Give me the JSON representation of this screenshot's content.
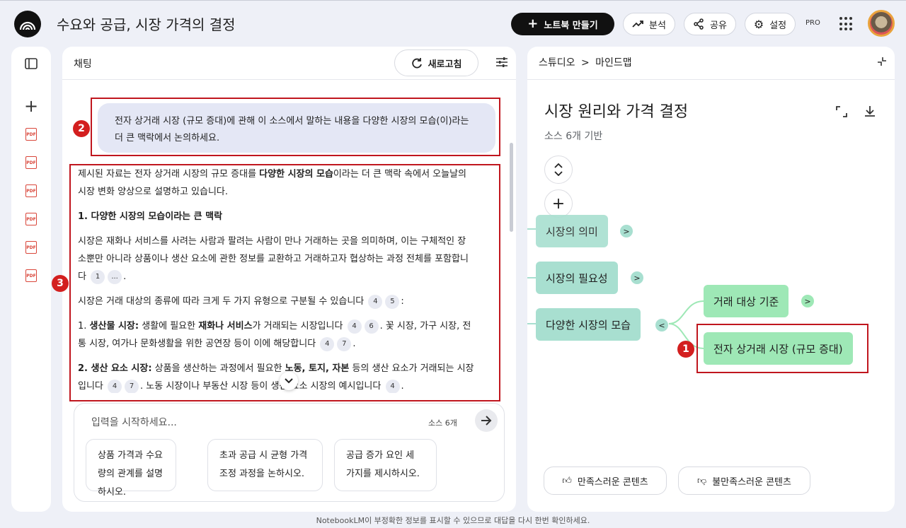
{
  "header": {
    "title": "수요와 공급, 시장 가격의 결정",
    "new_notebook": "노트북 만들기",
    "analytics": "분석",
    "share": "공유",
    "settings": "설정",
    "pro": "PRO"
  },
  "chat": {
    "title": "채팅",
    "refresh": "새로고침",
    "user_message": "전자 상거래 시장 (규모 증대)에 관해 이 소스에서 말하는 내용을 다양한 시장의 모습(이)라는 더 큰 맥락에서 논의하세요.",
    "answer": {
      "intro_1": "제시된 자료는 전자 상거래 시장의 규모 증대를 ",
      "intro_bold": "다양한 시장의 모습",
      "intro_2": "이라는 더 큰 맥락 속에서 오늘날의 시장 변화 양상으로 설명하고 있습니다.",
      "heading_1": "1. 다양한 시장의 모습이라는 큰 맥락",
      "para_1": "시장은 재화나 서비스를 사려는 사람과 팔려는 사람이 만나 거래하는 곳을 의미하며, 이는 구체적인 장소뿐만 아니라 상품이나 생산 요소에 관한 정보를 교환하고 거래하고자 협상하는 과정 전체를 포함합니다",
      "para_1_cites": [
        "1",
        "..."
      ],
      "para_2": "시장은 거래 대상의 종류에 따라 크게 두 가지 유형으로 구분될 수 있습니다",
      "para_2_cites": [
        "4",
        "5"
      ],
      "item_1_num": "1. ",
      "item_1_label": "생산물 시장:",
      "item_1_a": " 생활에 필요한 ",
      "item_1_bold": "재화나 서비스",
      "item_1_b": "가 거래되는 시장입니다",
      "item_1_cites": [
        "4",
        "6"
      ],
      "item_1_c": ". 꽃 시장, 가구 시장, 전통 시장, 여가나 문화생활을 위한 공연장 등이 이에 해당합니다",
      "item_1_cites_2": [
        "4",
        "7"
      ],
      "item_2_num": "2. ",
      "item_2_label": "생산 요소 시장:",
      "item_2_a": " 상품을 생산하는 과정에서 필요한 ",
      "item_2_bold": "노동, 토지, 자본",
      "item_2_b": " 등의 생산 요소가 거래되는 시장입니다",
      "item_2_cites": [
        "4",
        "7"
      ],
      "item_2_c": ". 노동 시장이나 부동산 시장 등이 생산 요소 시장의 예시입니다",
      "item_2_cites_2": [
        "4"
      ]
    },
    "input_placeholder": "입력을 시작하세요...",
    "source_count": "소스 6개",
    "suggestions": [
      "상품 가격과 수요량의 관계를 설명하시오.",
      "초과 공급 시 균형 가격 조정 과정을 논하시오.",
      "공급 증가 요인 세 가지를 제시하시오."
    ]
  },
  "studio": {
    "breadcrumb_1": "스튜디오",
    "breadcrumb_2": "마인드맵",
    "map_title": "시장 원리와 가격 결정",
    "map_subtitle": "소스 6개 기반",
    "nodes": {
      "meaning": "시장의 의미",
      "necessity": "시장의 필요성",
      "various": "다양한 시장의 모습",
      "by_target": "거래 대상 기준",
      "ecommerce": "전자 상거래 시장 (규모 증대)"
    },
    "satisfied": "만족스러운 콘텐츠",
    "unsatisfied": "불만족스러운 콘텐츠"
  },
  "annotations": {
    "badge_1": "1",
    "badge_2": "2",
    "badge_3": "3"
  },
  "footer": "NotebookLM이 부정확한 정보를 표시할 수 있으므로 대답을 다시 한번 확인하세요.",
  "colors": {
    "accent_red": "#c0161e",
    "node_teal": "#a8dfd0",
    "node_green": "#9ee8b6"
  }
}
